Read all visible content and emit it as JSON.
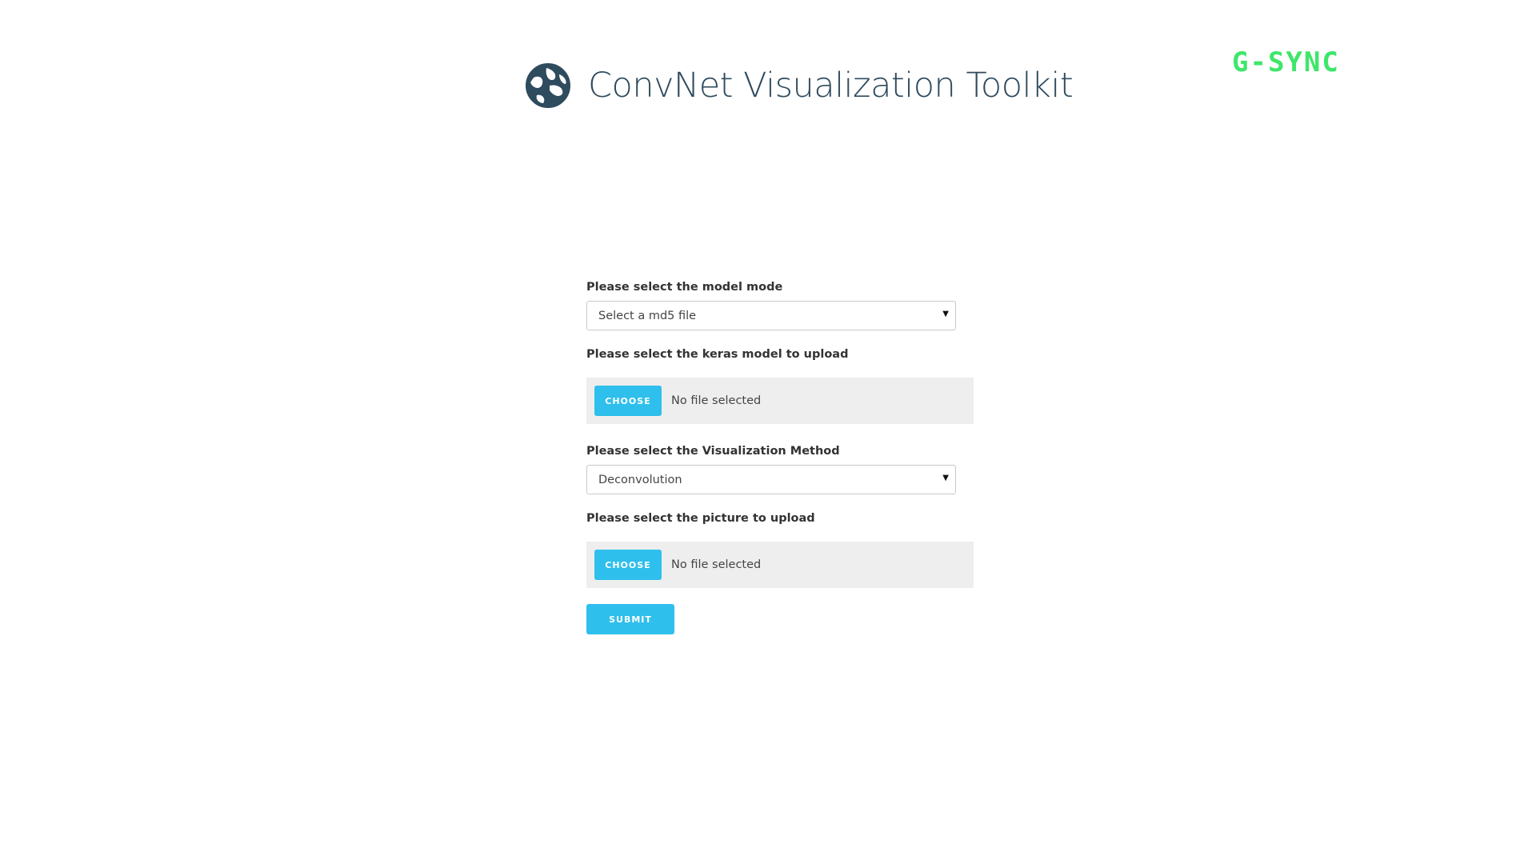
{
  "header": {
    "title": "ConvNet Visualization Toolkit",
    "logo_icon": "globe-icon"
  },
  "overlay": {
    "badge_text": "G-SYNC",
    "color": "#3ee66a"
  },
  "form": {
    "model_mode": {
      "label": "Please select the model mode",
      "selected_value": "Select a md5 file"
    },
    "keras_upload": {
      "label": "Please select the keras model to upload",
      "button_label": "CHOOSE",
      "status": "No file selected"
    },
    "vis_method": {
      "label": "Please select the Visualization Method",
      "selected_value": "Deconvolution"
    },
    "picture_upload": {
      "label": "Please select the picture to upload",
      "button_label": "CHOOSE",
      "status": "No file selected"
    },
    "submit_label": "SUBMIT"
  },
  "colors": {
    "accent": "#2fbfec",
    "title": "#2f4b5e",
    "file_box_bg": "#eeeeee"
  }
}
